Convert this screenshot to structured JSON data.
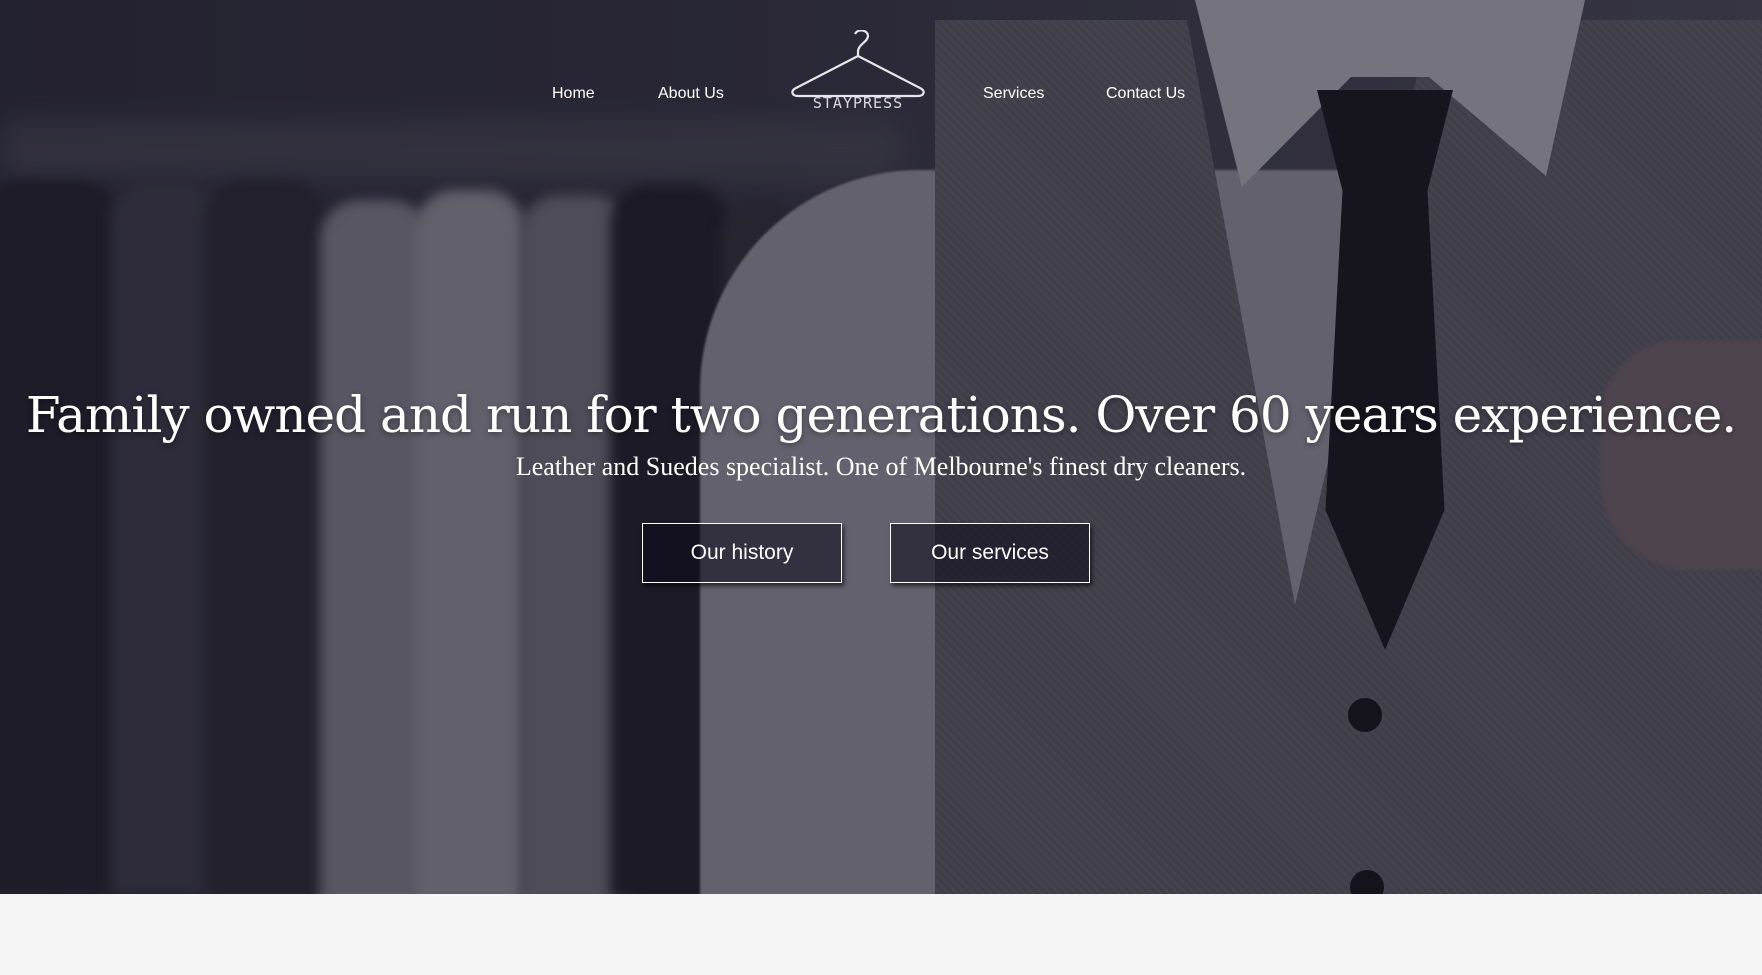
{
  "nav": {
    "left": [
      "Home",
      "About Us"
    ],
    "right": [
      "Services",
      "Contact Us"
    ]
  },
  "logo": {
    "text": "STAYPRESS",
    "icon": "hanger-icon"
  },
  "hero": {
    "headline": "Family owned and run for two generations. Over 60 years experience.",
    "subheadline": "Leather and Suedes specialist. One of Melbourne's finest dry cleaners.",
    "buttons": [
      "Our history",
      "Our services"
    ]
  },
  "colors": {
    "overlay": "#141222",
    "text": "#ffffff",
    "below_background": "#f5f5f5"
  }
}
